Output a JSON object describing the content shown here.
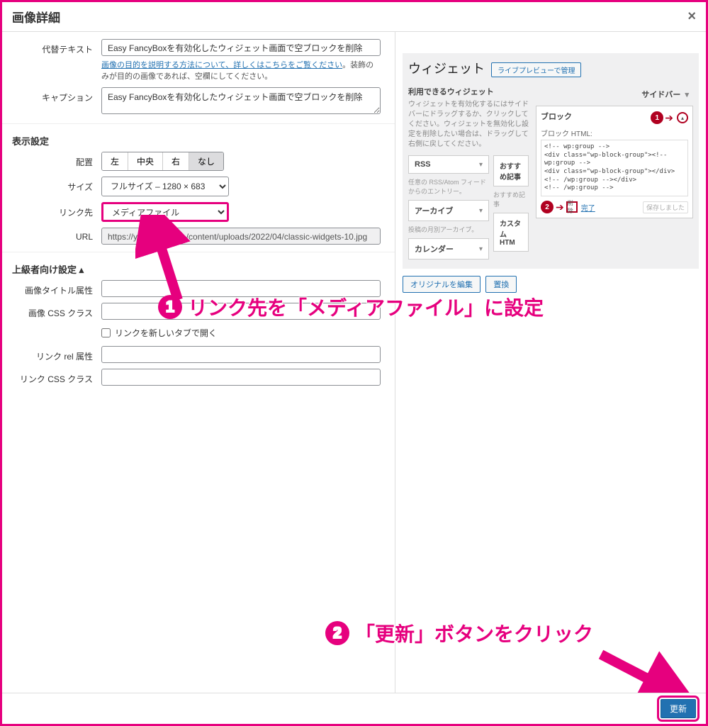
{
  "modal_title": "画像詳細",
  "labels": {
    "alt_text": "代替テキスト",
    "caption": "キャプション",
    "display_settings": "表示設定",
    "align": "配置",
    "size": "サイズ",
    "link_to": "リンク先",
    "url": "URL",
    "advanced": "上級者向け設定 ▴",
    "image_title_attr": "画像タイトル属性",
    "image_css_class": "画像 CSS クラス",
    "open_new_tab": "リンクを新しいタブで開く",
    "link_rel": "リンク rel 属性",
    "link_css_class": "リンク CSS クラス"
  },
  "values": {
    "alt_text": "Easy FancyBoxを有効化したウィジェット画面で空ブロックを削除",
    "caption": "Easy FancyBoxを有効化したウィジェット画面で空ブロックを削除",
    "url": "https://yublog.　　　/content/uploads/2022/04/classic-widgets-10.jpg"
  },
  "help_text": {
    "alt_link": "画像の目的を説明する方法について、詳しくはこちらをご覧ください",
    "alt_suffix": "。装飾のみが目的の画像であれば、空欄にしてください。"
  },
  "align_buttons": {
    "left": "左",
    "center": "中央",
    "right": "右",
    "none": "なし"
  },
  "size_value": "フルサイズ – 1280 × 683",
  "link_to_value": "メディアファイル",
  "preview": {
    "widget_title": "ウィジェット",
    "live_preview_btn": "ライブプレビューで管理",
    "available_title": "利用できるウィジェット",
    "hint": "ウィジェットを有効化するにはサイドバーにドラッグするか、クリックしてください。ウィジェットを無効化し設定を削除したい場合は、ドラッグして右側に戻してください。",
    "sidebar_label": "サイドバー",
    "widgets": {
      "rss": "RSS",
      "rss_desc": "任意の RSS/Atom フィードからのエントリー。",
      "recommended": "おすすめ記事",
      "recommended_desc": "おすすめ記事",
      "archive": "アーカイブ",
      "archive_desc": "投稿の月別アーカイブ。",
      "custom_html": "カスタム HTM",
      "calendar": "カレンダー"
    },
    "block_label": "ブロック",
    "block_html_label": "ブロック HTML:",
    "block_html": "<!-- wp:group -->\n<div class=\"wp-block-group\"><!-- wp:group -->\n<div class=\"wp-block-group\"></div>\n<!-- /wp:group --></div>\n<!-- /wp:group -->",
    "delete_link": "削除",
    "done_link": "完了",
    "saved_note": "保存しました",
    "edit_original": "オリジナルを編集",
    "replace": "置換"
  },
  "annotations": {
    "a1": "リンク先を「メディアファイル」に設定",
    "a2": "「更新」ボタンをクリック"
  },
  "update_btn": "更新"
}
